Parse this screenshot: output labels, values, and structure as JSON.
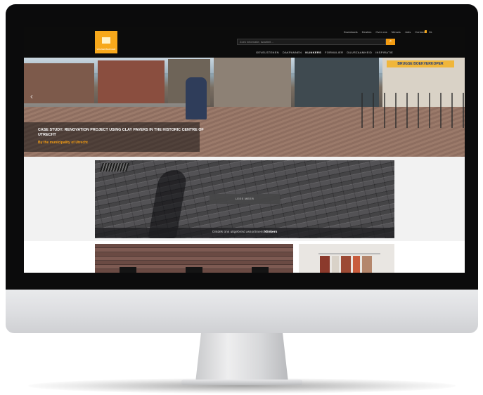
{
  "header": {
    "logo_text": "WIENERBERGER",
    "util_links": [
      "Downloads",
      "Dealers",
      "Over ons",
      "Nieuws",
      "Jobs",
      "Contact"
    ],
    "language_label": "NL",
    "search_placeholder": "Zoek informatie, kwaliteit ...",
    "search_button_icon": "search-icon",
    "nav": [
      {
        "label": "GEVELSTENEN",
        "active": false
      },
      {
        "label": "DAKPANNEN",
        "active": false
      },
      {
        "label": "KLINKERS",
        "active": true
      },
      {
        "label": "FORMULIER",
        "active": false
      },
      {
        "label": "DUURZAAMHEID",
        "active": false
      },
      {
        "label": "INSPIRATIE",
        "active": false
      }
    ]
  },
  "hero": {
    "title": "CASE STUDY: RENOVATION PROJECT USING CLAY PAVERS IN THE HISTORIC CENTRE OF UTRECHT",
    "subtitle": "By the municipality of Utrecht",
    "prev_icon": "chevron-left-icon",
    "shop_sign": "BRUGSE BOEKVERKOPER"
  },
  "feature": {
    "button_label": "LEES MEER",
    "caption_prefix": "Ontdek ons uitgebreid assortiment ",
    "caption_bold": "klinkers"
  },
  "colors": {
    "accent": "#f39c12",
    "topbar": "#0c0c0c"
  }
}
